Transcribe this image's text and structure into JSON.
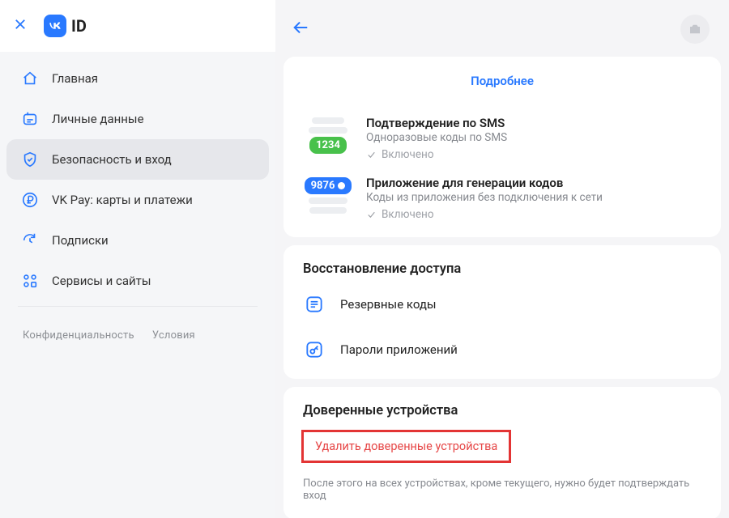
{
  "header": {
    "logo_text": "ID"
  },
  "sidebar": {
    "items": [
      {
        "label": "Главная"
      },
      {
        "label": "Личные данные"
      },
      {
        "label": "Безопасность и вход"
      },
      {
        "label": "VK Pay: карты и платежи"
      },
      {
        "label": "Подписки"
      },
      {
        "label": "Сервисы и сайты"
      }
    ],
    "footer": {
      "privacy": "Конфиденциальность",
      "terms": "Условия"
    }
  },
  "main": {
    "more": "Подробнее",
    "methods": [
      {
        "chip": "1234",
        "title": "Подтверждение по SMS",
        "sub": "Одноразовые коды по SMS",
        "status": "Включено"
      },
      {
        "chip": "9876",
        "title": "Приложение для генерации кодов",
        "sub": "Коды из приложения без подключения к сети",
        "status": "Включено"
      }
    ],
    "recovery": {
      "heading": "Восстановление доступа",
      "items": [
        {
          "label": "Резервные коды"
        },
        {
          "label": "Пароли приложений"
        }
      ]
    },
    "trusted": {
      "heading": "Доверенные устройства",
      "delete": "Удалить доверенные устройства",
      "hint": "После этого на всех устройствах, кроме текущего, нужно будет подтверждать вход"
    }
  }
}
